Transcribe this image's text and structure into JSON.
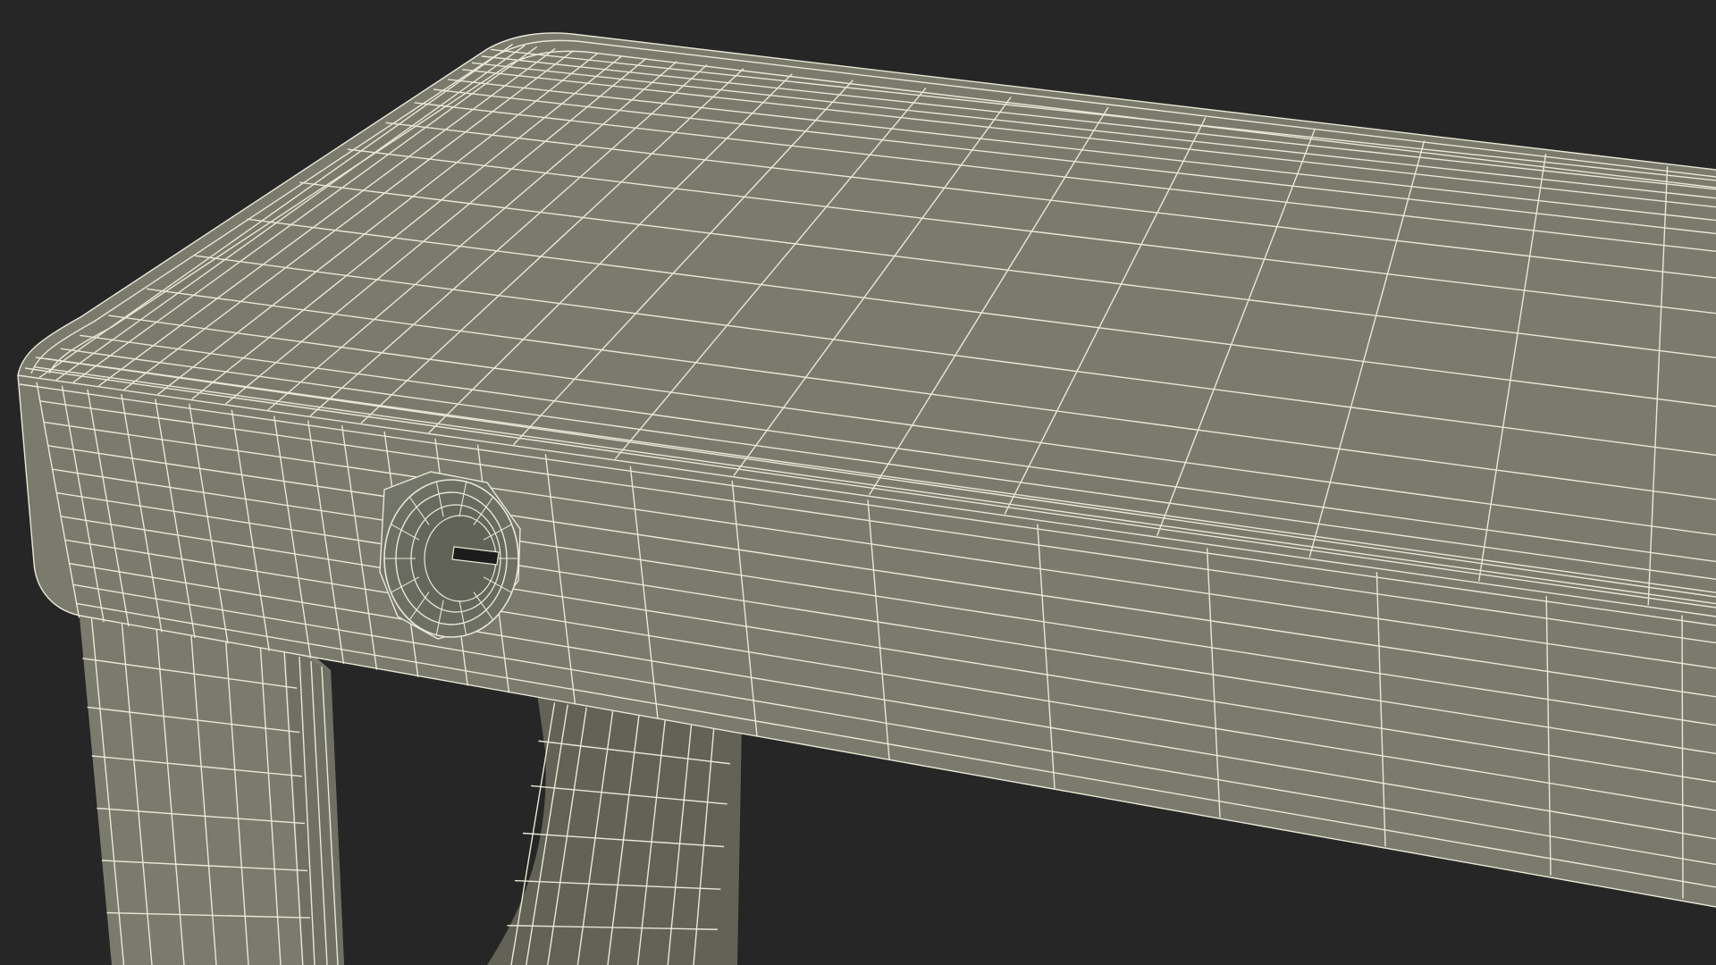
{
  "scene": {
    "subject": "wireframe-desk",
    "background_color": "#262626",
    "surface_color": "#7a7b6d",
    "surface_shadow_color": "#6a6b5e",
    "inner_leg_color": "#626356",
    "wire_color": "#e9e8d6",
    "keyhole_color": "#1c1c1c"
  }
}
